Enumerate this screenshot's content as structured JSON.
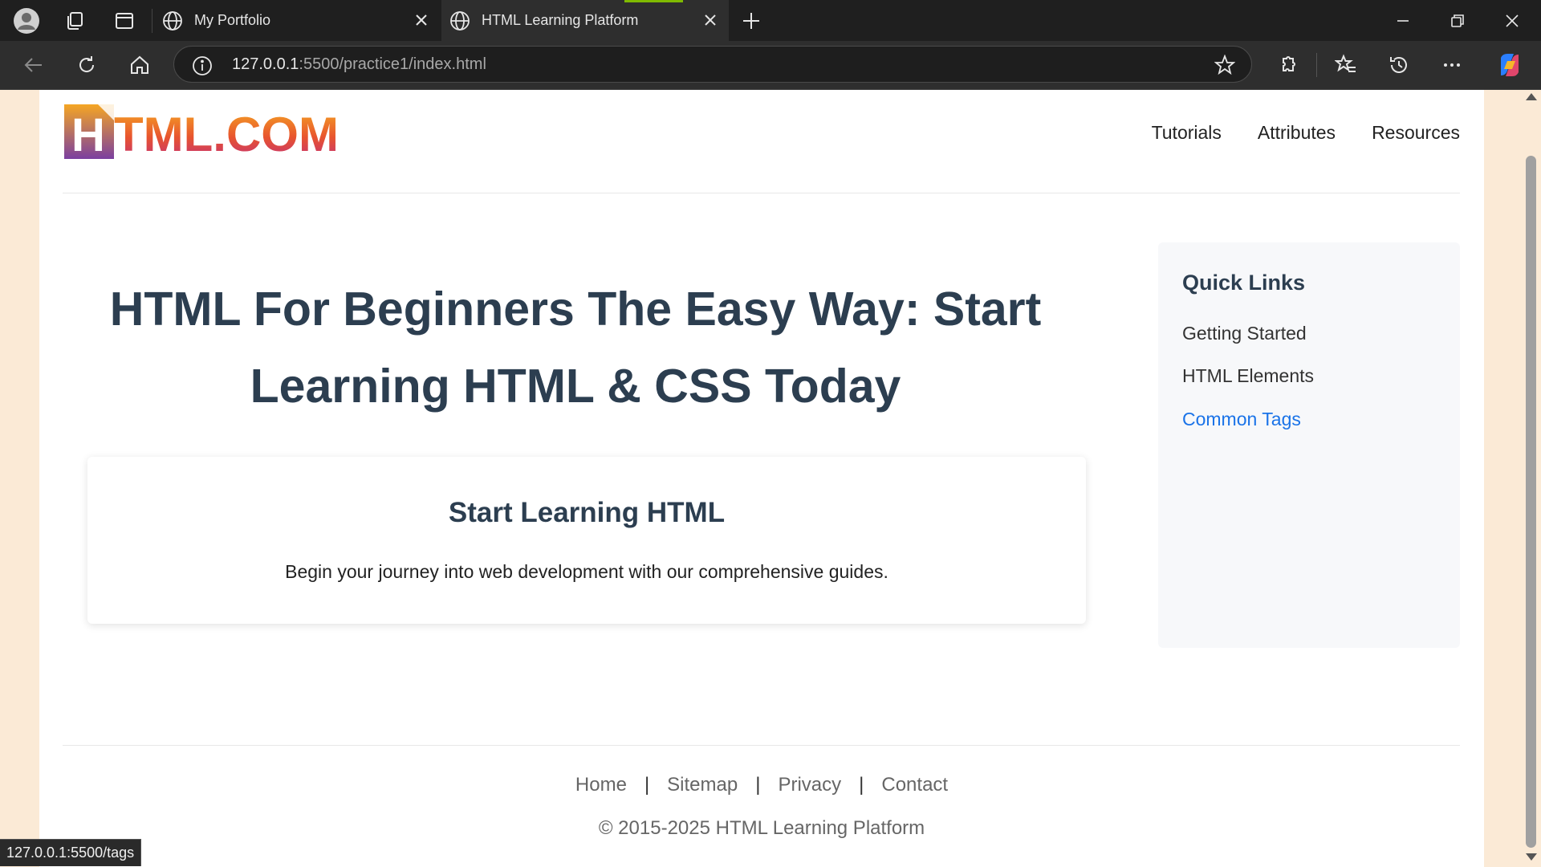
{
  "browser": {
    "tabs": [
      {
        "title": "My Portfolio",
        "active": false
      },
      {
        "title": "HTML Learning Platform",
        "active": true
      }
    ],
    "address": {
      "host": "127.0.0.1",
      "path": ":5500/practice1/index.html"
    },
    "status_url": "127.0.0.1:5500/tags",
    "accent_color": "#7fba00"
  },
  "header": {
    "logo_text": "HTML.COM",
    "nav": [
      {
        "label": "Tutorials"
      },
      {
        "label": "Attributes"
      },
      {
        "label": "Resources"
      }
    ]
  },
  "main": {
    "hero_line1": "HTML For Beginners The Easy Way: Start",
    "hero_line2": "Learning HTML & CSS Today",
    "card": {
      "title": "Start Learning HTML",
      "text": "Begin your journey into web development with our comprehensive guides."
    }
  },
  "sidebar": {
    "title": "Quick Links",
    "links": [
      {
        "label": "Getting Started"
      },
      {
        "label": "HTML Elements"
      },
      {
        "label": "Common Tags",
        "state": "hover",
        "color": "#1a73e8"
      }
    ]
  },
  "footer": {
    "links": [
      {
        "label": "Home"
      },
      {
        "label": "Sitemap"
      },
      {
        "label": "Privacy"
      },
      {
        "label": "Contact"
      }
    ],
    "separator": "|",
    "copyright": "© 2015-2025 HTML Learning Platform"
  },
  "colors": {
    "heading": "#2c3e50",
    "page_bg": "#fbead6",
    "chrome_dark": "#1f1f1f"
  }
}
